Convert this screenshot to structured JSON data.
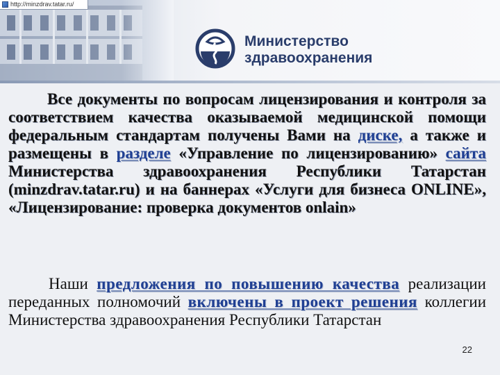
{
  "browser": {
    "url": "http://minzdrav.tatar.ru/"
  },
  "header": {
    "ministry_line1": "Министерство",
    "ministry_line2": "здравоохранения",
    "emblem_icon": "medical-snake-emblem-icon"
  },
  "colors": {
    "link_blue": "#1f3f93",
    "title_navy": "#2a3d6b",
    "text": "#111111"
  },
  "para1": {
    "t1": "Все документы по вопросам лицензирования и контроля за соответствием качества оказываемой медицинской помощи федеральным стандартам получены Вами на ",
    "link_disk": "диске,",
    "t2": " а также и размещены в ",
    "link_section": "разделе",
    "t3": " «Управление по лицензированию» ",
    "link_site": "сайта",
    "t4": " Министерства здравоохранения Республики Татарстан ",
    "t5": "(minzdrav.tatar.ru) и на баннерах «Услуги для бизнеса ONLINE», «Лицензирование: проверка документов onlain»"
  },
  "para2": {
    "t1": "Наши ",
    "link_proposals": "предложения по повышению качества",
    "t2": " реализации переданных полномочий ",
    "link_included": "включены в проект решения",
    "t3": " коллегии Министерства здравоохранения Республики Татарстан"
  },
  "slide_number": "22"
}
